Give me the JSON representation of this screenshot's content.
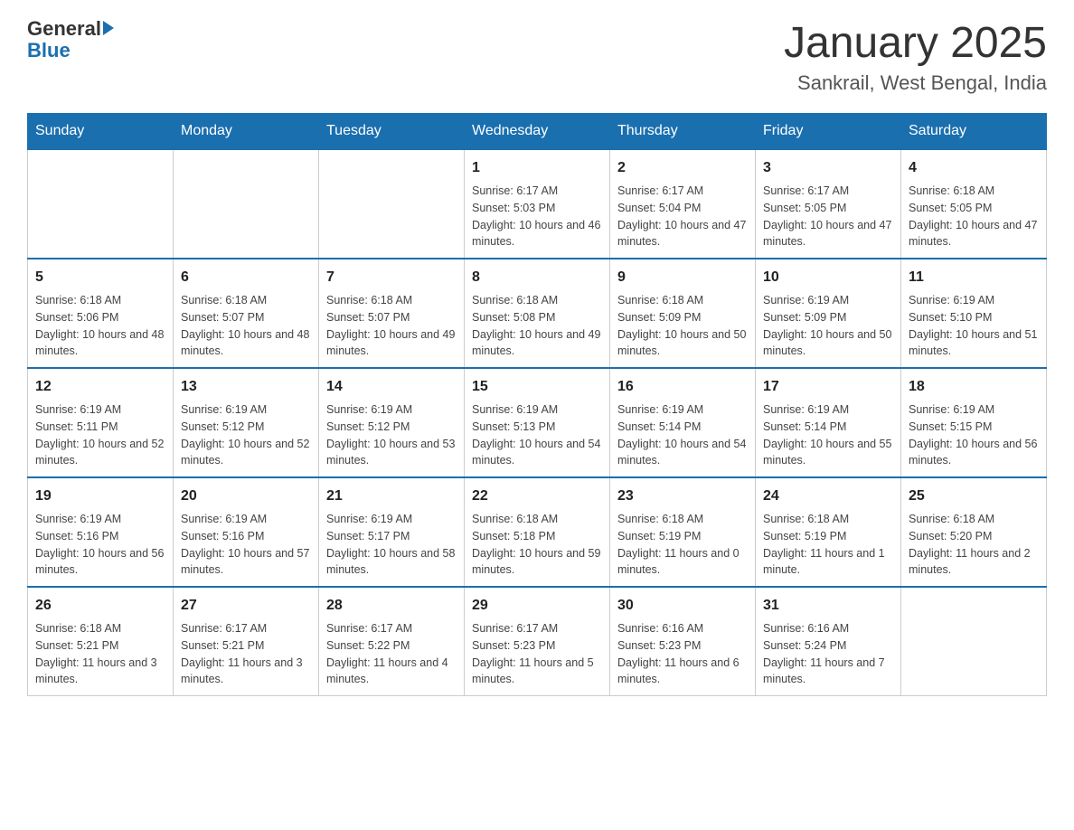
{
  "logo": {
    "general": "General",
    "blue": "Blue"
  },
  "title": "January 2025",
  "subtitle": "Sankrail, West Bengal, India",
  "headers": [
    "Sunday",
    "Monday",
    "Tuesday",
    "Wednesday",
    "Thursday",
    "Friday",
    "Saturday"
  ],
  "weeks": [
    [
      {
        "day": "",
        "info": ""
      },
      {
        "day": "",
        "info": ""
      },
      {
        "day": "",
        "info": ""
      },
      {
        "day": "1",
        "info": "Sunrise: 6:17 AM\nSunset: 5:03 PM\nDaylight: 10 hours and 46 minutes."
      },
      {
        "day": "2",
        "info": "Sunrise: 6:17 AM\nSunset: 5:04 PM\nDaylight: 10 hours and 47 minutes."
      },
      {
        "day": "3",
        "info": "Sunrise: 6:17 AM\nSunset: 5:05 PM\nDaylight: 10 hours and 47 minutes."
      },
      {
        "day": "4",
        "info": "Sunrise: 6:18 AM\nSunset: 5:05 PM\nDaylight: 10 hours and 47 minutes."
      }
    ],
    [
      {
        "day": "5",
        "info": "Sunrise: 6:18 AM\nSunset: 5:06 PM\nDaylight: 10 hours and 48 minutes."
      },
      {
        "day": "6",
        "info": "Sunrise: 6:18 AM\nSunset: 5:07 PM\nDaylight: 10 hours and 48 minutes."
      },
      {
        "day": "7",
        "info": "Sunrise: 6:18 AM\nSunset: 5:07 PM\nDaylight: 10 hours and 49 minutes."
      },
      {
        "day": "8",
        "info": "Sunrise: 6:18 AM\nSunset: 5:08 PM\nDaylight: 10 hours and 49 minutes."
      },
      {
        "day": "9",
        "info": "Sunrise: 6:18 AM\nSunset: 5:09 PM\nDaylight: 10 hours and 50 minutes."
      },
      {
        "day": "10",
        "info": "Sunrise: 6:19 AM\nSunset: 5:09 PM\nDaylight: 10 hours and 50 minutes."
      },
      {
        "day": "11",
        "info": "Sunrise: 6:19 AM\nSunset: 5:10 PM\nDaylight: 10 hours and 51 minutes."
      }
    ],
    [
      {
        "day": "12",
        "info": "Sunrise: 6:19 AM\nSunset: 5:11 PM\nDaylight: 10 hours and 52 minutes."
      },
      {
        "day": "13",
        "info": "Sunrise: 6:19 AM\nSunset: 5:12 PM\nDaylight: 10 hours and 52 minutes."
      },
      {
        "day": "14",
        "info": "Sunrise: 6:19 AM\nSunset: 5:12 PM\nDaylight: 10 hours and 53 minutes."
      },
      {
        "day": "15",
        "info": "Sunrise: 6:19 AM\nSunset: 5:13 PM\nDaylight: 10 hours and 54 minutes."
      },
      {
        "day": "16",
        "info": "Sunrise: 6:19 AM\nSunset: 5:14 PM\nDaylight: 10 hours and 54 minutes."
      },
      {
        "day": "17",
        "info": "Sunrise: 6:19 AM\nSunset: 5:14 PM\nDaylight: 10 hours and 55 minutes."
      },
      {
        "day": "18",
        "info": "Sunrise: 6:19 AM\nSunset: 5:15 PM\nDaylight: 10 hours and 56 minutes."
      }
    ],
    [
      {
        "day": "19",
        "info": "Sunrise: 6:19 AM\nSunset: 5:16 PM\nDaylight: 10 hours and 56 minutes."
      },
      {
        "day": "20",
        "info": "Sunrise: 6:19 AM\nSunset: 5:16 PM\nDaylight: 10 hours and 57 minutes."
      },
      {
        "day": "21",
        "info": "Sunrise: 6:19 AM\nSunset: 5:17 PM\nDaylight: 10 hours and 58 minutes."
      },
      {
        "day": "22",
        "info": "Sunrise: 6:18 AM\nSunset: 5:18 PM\nDaylight: 10 hours and 59 minutes."
      },
      {
        "day": "23",
        "info": "Sunrise: 6:18 AM\nSunset: 5:19 PM\nDaylight: 11 hours and 0 minutes."
      },
      {
        "day": "24",
        "info": "Sunrise: 6:18 AM\nSunset: 5:19 PM\nDaylight: 11 hours and 1 minute."
      },
      {
        "day": "25",
        "info": "Sunrise: 6:18 AM\nSunset: 5:20 PM\nDaylight: 11 hours and 2 minutes."
      }
    ],
    [
      {
        "day": "26",
        "info": "Sunrise: 6:18 AM\nSunset: 5:21 PM\nDaylight: 11 hours and 3 minutes."
      },
      {
        "day": "27",
        "info": "Sunrise: 6:17 AM\nSunset: 5:21 PM\nDaylight: 11 hours and 3 minutes."
      },
      {
        "day": "28",
        "info": "Sunrise: 6:17 AM\nSunset: 5:22 PM\nDaylight: 11 hours and 4 minutes."
      },
      {
        "day": "29",
        "info": "Sunrise: 6:17 AM\nSunset: 5:23 PM\nDaylight: 11 hours and 5 minutes."
      },
      {
        "day": "30",
        "info": "Sunrise: 6:16 AM\nSunset: 5:23 PM\nDaylight: 11 hours and 6 minutes."
      },
      {
        "day": "31",
        "info": "Sunrise: 6:16 AM\nSunset: 5:24 PM\nDaylight: 11 hours and 7 minutes."
      },
      {
        "day": "",
        "info": ""
      }
    ]
  ]
}
